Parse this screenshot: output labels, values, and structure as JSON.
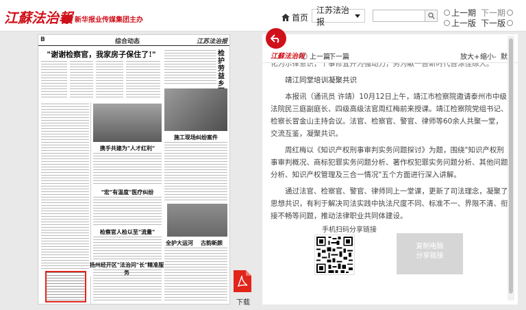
{
  "header": {
    "logo_text": "江蘇法治報",
    "logo_sub": "新华报业传媒集团主办",
    "home_label": "首页",
    "paper_select": "江苏法治报",
    "search_placeholder": "",
    "prev_issue": "上一期",
    "next_issue": "下一期",
    "prev_page": "上一版",
    "next_page": "下一版"
  },
  "paper": {
    "page_num": "B",
    "section": "综合动态",
    "name": "江苏法治报",
    "headline": "\"谢谢检察官，我家房子保住了!\"",
    "vertical_head": "检护劳益 乡野更",
    "subhead_1": "携手共建为\"人才红利\"",
    "subhead_2": "\"宏\"有温度\"医疗纠纷",
    "subhead_3": "检察官人检以至\"流量\"",
    "subhead_4": "扬州经开区\"法治问\"长\"精准服务",
    "subhead_5": "施工现场纠纷案件",
    "subhead_6": "全护大运河",
    "subhead_7": "古韵新颜",
    "download_label": "下载"
  },
  "reader": {
    "logo": "江蘇法治報",
    "prev_article": "上一篇",
    "next_article": "下一篇",
    "zoom_in": "放大+",
    "zoom_out": "缩小-",
    "zoom_default": "默认",
    "cut_line": "化为示律意识，个事修宜开为强动力，另为献一吾新时代吾涂佳综大。",
    "title": "靖江同堂培训凝聚共识",
    "para_1": "本报讯（通讯员 许靖）10月12日上午，靖江市检察院邀请泰州市中级法院民三庭副庭长、四级高级法官周红梅前来授课。靖江检察院党组书记、检察长冒金山主持会议。法官、检察官、警官、律师等60余人共聚一堂，交流互鉴，凝聚共识。",
    "para_2": "周红梅以《知识产权刑事审判实务问题探讨》为题，围绕\"知识产权刑事审判概况、商标犯罪实务问题分析、著作权犯罪实务问题分析、其他问题分析、知识产权管理及三合一情况\"五个方面进行深入讲解。",
    "para_3": "通过法官、检察官、警官、律师同上一堂课，更新了司法理念，凝聚了思想共识，有利于解决司法实践中执法尺度不同、标准不一、界限不清、衔接不畅等问题，推动法律职业共同体建设。",
    "share_label": "手机扫码分享链接",
    "copy_button": "复制电脑\n分享链接"
  },
  "colors": {
    "brand_red": "#d0111b",
    "highlight_red": "#e1251b"
  }
}
